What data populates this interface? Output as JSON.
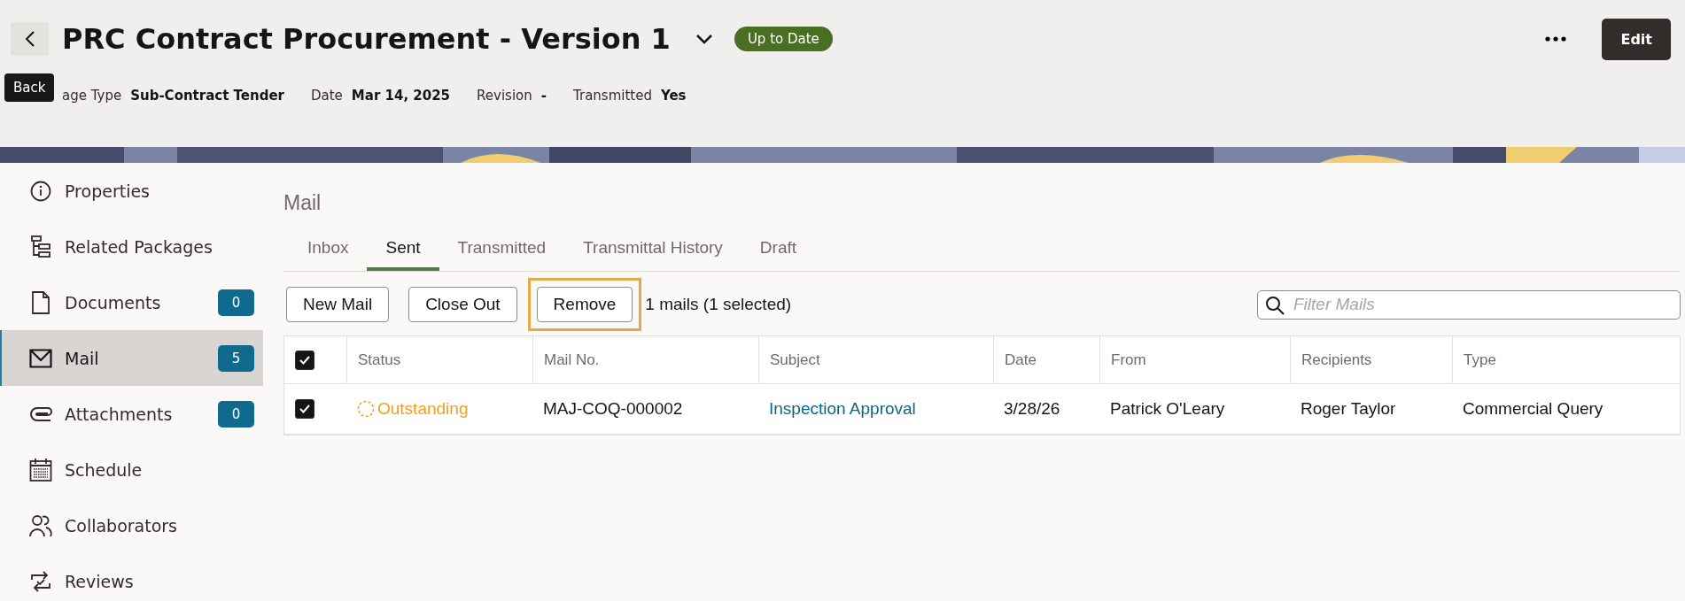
{
  "header": {
    "title": "PRC Contract Procurement - Version 1",
    "status_badge": "Up to Date",
    "edit_button": "Edit",
    "back_tooltip": "Back",
    "meta": [
      {
        "label": "age Type",
        "value": "Sub-Contract Tender"
      },
      {
        "label": "Date",
        "value": "Mar 14, 2025"
      },
      {
        "label": "Revision",
        "value": "-"
      },
      {
        "label": "Transmitted",
        "value": "Yes"
      }
    ]
  },
  "sidebar": {
    "items": [
      {
        "label": "Properties",
        "selected": false
      },
      {
        "label": "Related Packages",
        "selected": false
      },
      {
        "label": "Documents",
        "count": "0",
        "selected": false
      },
      {
        "label": "Mail",
        "count": "5",
        "selected": true
      },
      {
        "label": "Attachments",
        "count": "0",
        "selected": false
      },
      {
        "label": "Schedule",
        "selected": false
      },
      {
        "label": "Collaborators",
        "selected": false
      },
      {
        "label": "Reviews",
        "selected": false
      }
    ]
  },
  "mail": {
    "title": "Mail",
    "tabs": [
      {
        "label": "Inbox",
        "selected": false
      },
      {
        "label": "Sent",
        "selected": true
      },
      {
        "label": "Transmitted",
        "selected": false
      },
      {
        "label": "Transmittal History",
        "selected": false
      },
      {
        "label": "Draft",
        "selected": false
      }
    ],
    "buttons": [
      {
        "label": "New Mail",
        "focused": false
      },
      {
        "label": "Close Out",
        "focused": false
      },
      {
        "label": "Remove",
        "focused": true
      }
    ],
    "summary": "1 mails (1 selected)",
    "filter": {
      "placeholder": "Filter Mails"
    },
    "table": {
      "select_all_checked": true,
      "columns": [
        "Status",
        "Mail No.",
        "Subject",
        "Date",
        "From",
        "Recipients",
        "Type"
      ],
      "rows": [
        {
          "checked": true,
          "status": "Outstanding",
          "mail_no": "MAJ-COQ-000002",
          "subject": "Inspection Approval",
          "date": "3/28/26",
          "from": "Patrick O'Leary",
          "recipients": "Roger Taylor",
          "type": "Commercial Query"
        }
      ]
    }
  }
}
